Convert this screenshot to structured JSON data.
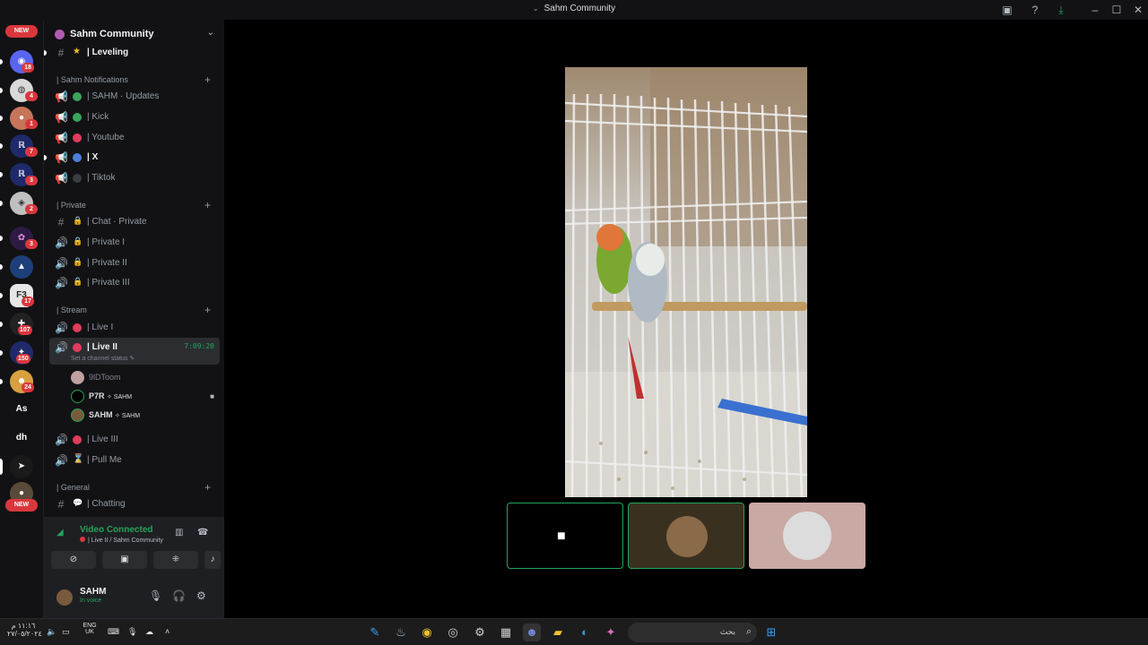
{
  "window": {
    "title": "Sahm Community"
  },
  "rail": {
    "new_top": "NEW",
    "new_bottom": "NEW",
    "badges": [
      "18",
      "4",
      "1",
      "7",
      "3",
      "2",
      "3",
      "17",
      "107",
      "150",
      "24"
    ],
    "text_servers": [
      "As",
      "dh"
    ]
  },
  "guild": {
    "name": "Sahm Community"
  },
  "channels": {
    "leveling": "| Leveling",
    "categories": {
      "notifications": "| Sahm Notifications",
      "private": "| Private",
      "stream": "| Stream",
      "general": "| General"
    },
    "notifications": [
      "| SAHM · Updates",
      "| Kick",
      "| Youtube",
      "| X",
      "| Tiktok"
    ],
    "private": [
      "| Chat · Private",
      "| Private I",
      "| Private II",
      "| Private III"
    ],
    "stream": [
      "| Live I",
      "| Live II",
      "| Live III",
      "| Pull Me"
    ],
    "general": [
      "| Chatting"
    ],
    "live_timer": "7:09:20",
    "status_prompt": "Set a channel status"
  },
  "members": [
    {
      "name": "9lDToom",
      "tag": ""
    },
    {
      "name": "P7R",
      "tag": "✧ SAHM"
    },
    {
      "name": "SAHM",
      "tag": "✧ SAHM"
    }
  ],
  "voice": {
    "title": "Video Connected",
    "subtitle": "| Live II / Sahm Community"
  },
  "user": {
    "name": "SAHM",
    "status": "In voice"
  },
  "taskbar": {
    "lang_top": "ENG",
    "lang_bottom": "UK",
    "search_placeholder": "بحث",
    "clock_top": "١١:١٦ م",
    "clock_bottom": "٢٧/٠٥/٢٠٢٤"
  }
}
